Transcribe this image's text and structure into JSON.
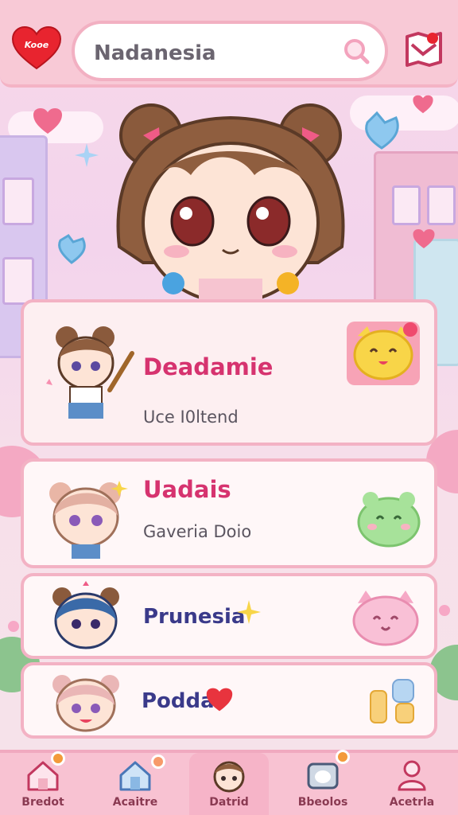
{
  "header": {
    "logo_text": "Kooe",
    "search_value": "Nadanesia"
  },
  "cards": [
    {
      "title": "Deadamie",
      "subtitle": "Uce I0ltend",
      "title_color": "#d6336f"
    },
    {
      "title": "Uadais",
      "subtitle": "Gaveria Doio",
      "title_color": "#d6336f"
    },
    {
      "title": "Prunesia",
      "subtitle": "",
      "title_color": "#3a3a8a"
    },
    {
      "title": "Podda",
      "subtitle": "",
      "title_color": "#3a3a8a"
    }
  ],
  "nav": {
    "items": [
      {
        "label": "Bredot"
      },
      {
        "label": "Acaitre"
      },
      {
        "label": "Datrid"
      },
      {
        "label": "Bbeolos"
      },
      {
        "label": "Acetrla"
      }
    ]
  },
  "colors": {
    "primary_pink": "#f3b2c4",
    "accent_magenta": "#d6336f",
    "header_bg": "#f8c9d6"
  },
  "icons": [
    "heart-logo-icon",
    "search-icon",
    "map-icon",
    "home-icon",
    "house-icon",
    "face-icon",
    "tv-icon",
    "user-icon"
  ]
}
